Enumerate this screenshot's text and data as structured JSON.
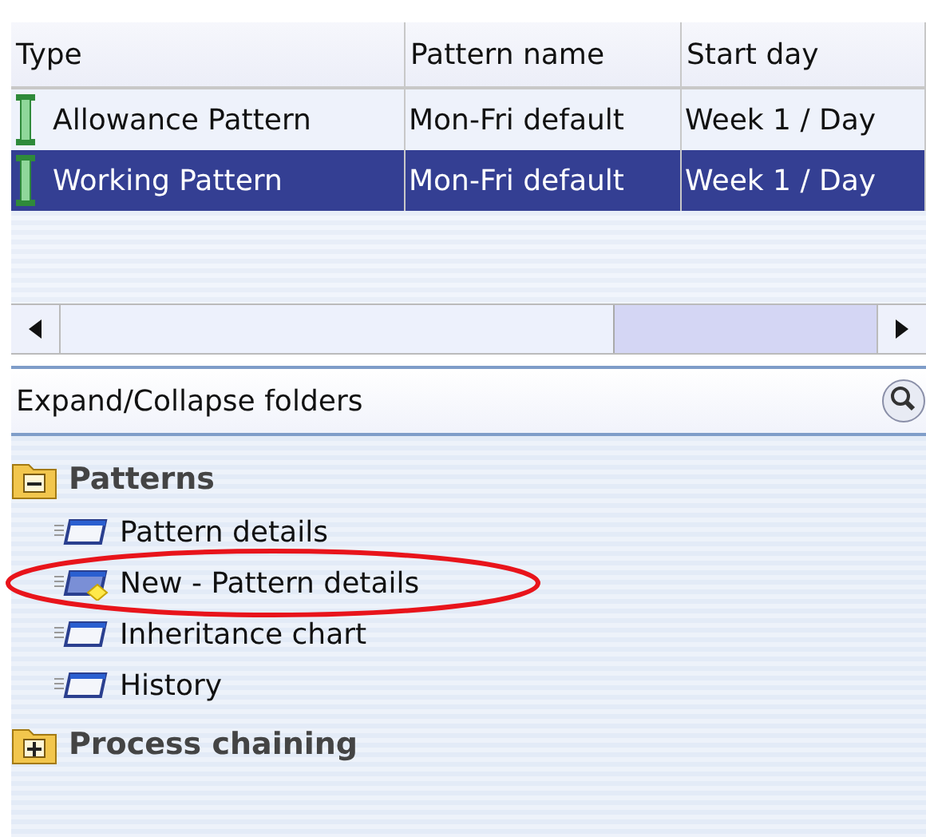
{
  "table": {
    "columns": [
      "Type",
      "Pattern name",
      "Start day"
    ],
    "rows": [
      {
        "cells": [
          "Allowance Pattern",
          "Mon-Fri default",
          "Week 1 / Day"
        ],
        "selected": false
      },
      {
        "cells": [
          "Working Pattern",
          "Mon-Fri default",
          "Week 1 / Day"
        ],
        "selected": true
      }
    ]
  },
  "panel": {
    "title": "Expand/Collapse folders"
  },
  "tree": [
    {
      "label": "Patterns",
      "expanded": true,
      "children": [
        {
          "label": "Pattern details",
          "kind": "form",
          "highlighted": false
        },
        {
          "label": "New - Pattern details",
          "kind": "new-form",
          "highlighted": true
        },
        {
          "label": "Inheritance chart",
          "kind": "form",
          "highlighted": false
        },
        {
          "label": "History",
          "kind": "form",
          "highlighted": false
        }
      ]
    },
    {
      "label": "Process chaining",
      "expanded": false
    }
  ]
}
